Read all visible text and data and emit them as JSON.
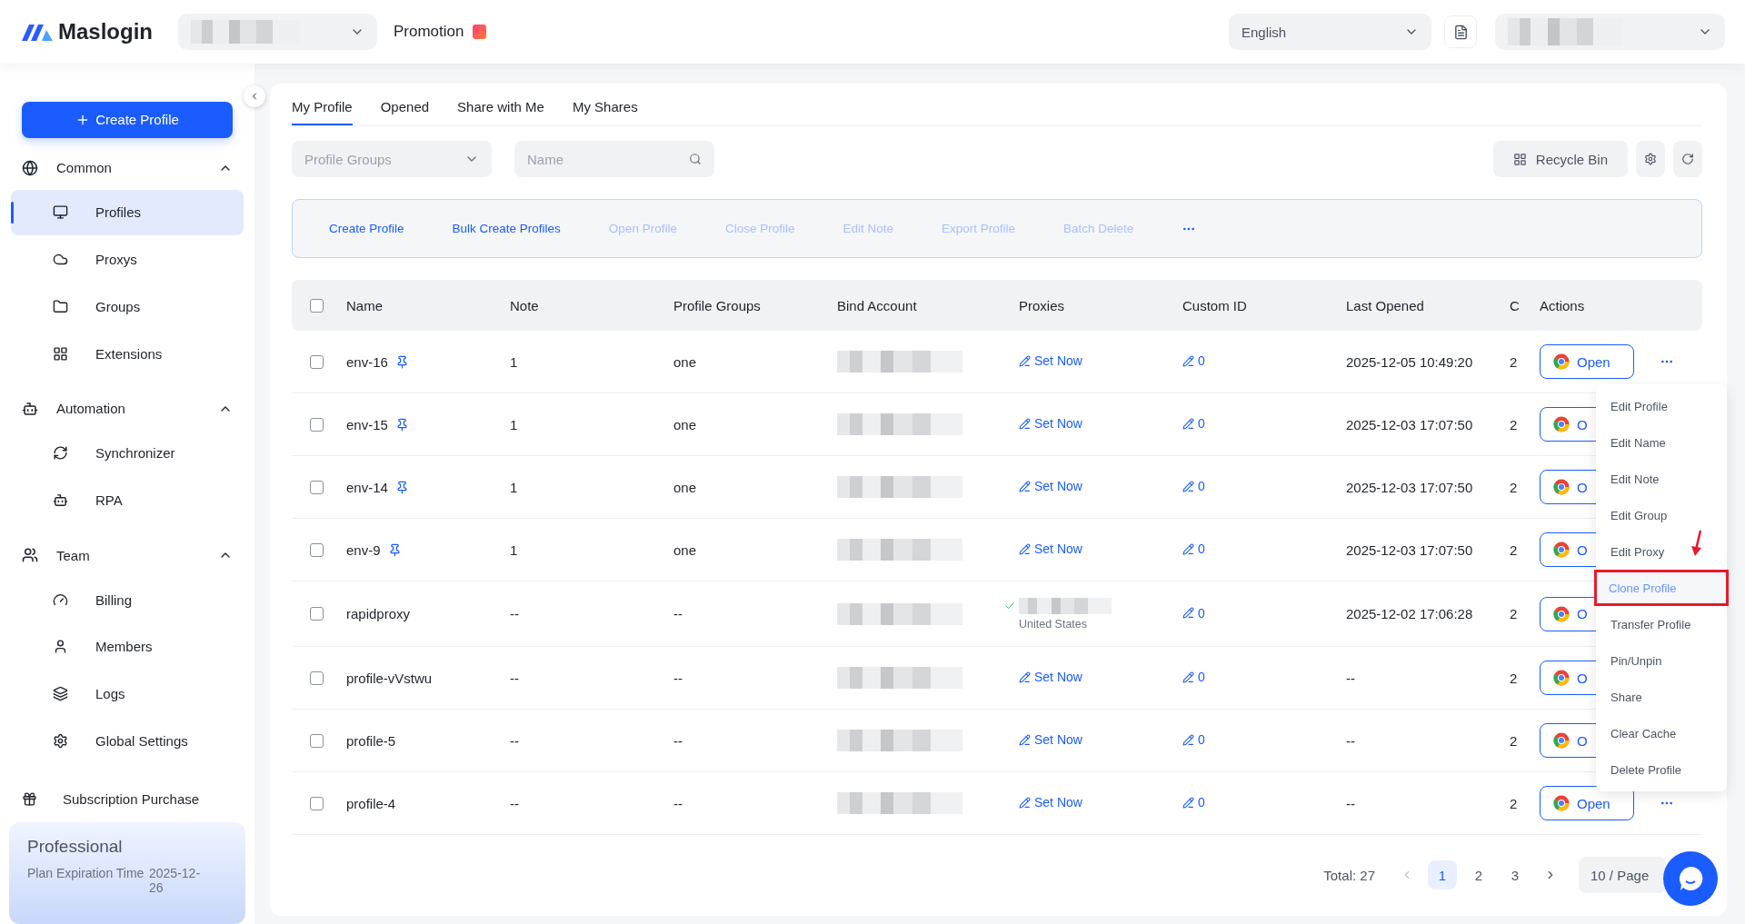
{
  "header": {
    "logo_text": "Maslogin",
    "promotion": "Promotion",
    "language": "English"
  },
  "sidebar": {
    "create_button": "Create Profile",
    "sections": [
      {
        "label": "Common",
        "expanded": true,
        "children": [
          {
            "label": "Profiles",
            "selected": true
          },
          {
            "label": "Proxys",
            "selected": false
          },
          {
            "label": "Groups",
            "selected": false
          },
          {
            "label": "Extensions",
            "selected": false
          }
        ]
      },
      {
        "label": "Automation",
        "expanded": true,
        "children": [
          {
            "label": "Synchronizer",
            "selected": false
          },
          {
            "label": "RPA",
            "selected": false
          }
        ]
      },
      {
        "label": "Team",
        "expanded": true,
        "children": [
          {
            "label": "Billing",
            "selected": false
          },
          {
            "label": "Members",
            "selected": false
          },
          {
            "label": "Logs",
            "selected": false
          },
          {
            "label": "Global Settings",
            "selected": false
          }
        ]
      }
    ],
    "footer_item": "Subscription Purchase",
    "plan": {
      "name": "Professional",
      "expiry_label": "Plan Expiration Time",
      "expiry_value": "2025-12-26"
    }
  },
  "main": {
    "tabs": [
      {
        "label": "My Profile",
        "selected": true
      },
      {
        "label": "Opened",
        "selected": false
      },
      {
        "label": "Share with Me",
        "selected": false
      },
      {
        "label": "My Shares",
        "selected": false
      }
    ],
    "group_select": {
      "placeholder": "Profile Groups"
    },
    "search": {
      "placeholder": "Name"
    },
    "recycle_bin": "Recycle Bin",
    "bulk_actions": [
      {
        "label": "Create Profile",
        "disabled": false
      },
      {
        "label": "Bulk Create Profiles",
        "disabled": false
      },
      {
        "label": "Open Profile",
        "disabled": true
      },
      {
        "label": "Close Profile",
        "disabled": true
      },
      {
        "label": "Edit Note",
        "disabled": true
      },
      {
        "label": "Export Profile",
        "disabled": true
      },
      {
        "label": "Batch Delete",
        "disabled": true
      }
    ],
    "table": {
      "select_all_checked": false,
      "columns": [
        "Name",
        "Note",
        "Profile Groups",
        "Bind Account",
        "Proxies",
        "Custom ID",
        "Last Opened",
        "C",
        "Actions"
      ],
      "rows": [
        {
          "checked": false,
          "name": "env-16",
          "pinned": true,
          "note": "1",
          "group": "one",
          "proxy": {
            "kind": "unset",
            "label": "Set Now"
          },
          "custom_id": "0",
          "last_opened": "2025-12-05 10:49:20",
          "column_9": "2",
          "open_label": "Open"
        },
        {
          "checked": false,
          "name": "env-15",
          "pinned": true,
          "note": "1",
          "group": "one",
          "proxy": {
            "kind": "unset",
            "label": "Set Now"
          },
          "custom_id": "0",
          "last_opened": "2025-12-03 17:07:50",
          "column_9": "2",
          "open_label": "O"
        },
        {
          "checked": false,
          "name": "env-14",
          "pinned": true,
          "note": "1",
          "group": "one",
          "proxy": {
            "kind": "unset",
            "label": "Set Now"
          },
          "custom_id": "0",
          "last_opened": "2025-12-03 17:07:50",
          "column_9": "2",
          "open_label": "O"
        },
        {
          "checked": false,
          "name": "env-9",
          "pinned": true,
          "note": "1",
          "group": "one",
          "proxy": {
            "kind": "unset",
            "label": "Set Now"
          },
          "custom_id": "0",
          "last_opened": "2025-12-03 17:07:50",
          "column_9": "2",
          "open_label": "O"
        },
        {
          "checked": false,
          "name": "rapidproxy",
          "pinned": false,
          "note": "--",
          "group": "--",
          "proxy": {
            "kind": "set",
            "country": "United States"
          },
          "custom_id": "0",
          "last_opened": "2025-12-02 17:06:28",
          "column_9": "2",
          "open_label": "O"
        },
        {
          "checked": false,
          "name": "profile-vVstwu",
          "pinned": false,
          "note": "--",
          "group": "--",
          "proxy": {
            "kind": "unset",
            "label": "Set Now"
          },
          "custom_id": "0",
          "last_opened": "--",
          "column_9": "2",
          "open_label": "O"
        },
        {
          "checked": false,
          "name": "profile-5",
          "pinned": false,
          "note": "--",
          "group": "--",
          "proxy": {
            "kind": "unset",
            "label": "Set Now"
          },
          "custom_id": "0",
          "last_opened": "--",
          "column_9": "2",
          "open_label": "O"
        },
        {
          "checked": false,
          "name": "profile-4",
          "pinned": false,
          "note": "--",
          "group": "--",
          "proxy": {
            "kind": "unset",
            "label": "Set Now"
          },
          "custom_id": "0",
          "last_opened": "--",
          "column_9": "2",
          "open_label": "Open"
        }
      ]
    },
    "row_menu": [
      {
        "label": "Edit Profile",
        "selected": false
      },
      {
        "label": "Edit Name",
        "selected": false
      },
      {
        "label": "Edit Note",
        "selected": false
      },
      {
        "label": "Edit Group",
        "selected": false
      },
      {
        "label": "Edit Proxy",
        "selected": false
      },
      {
        "label": "Clone Profile",
        "selected": true
      },
      {
        "label": "Transfer Profile",
        "selected": false
      },
      {
        "label": "Pin/Unpin",
        "selected": false
      },
      {
        "label": "Share",
        "selected": false
      },
      {
        "label": "Clear Cache",
        "selected": false
      },
      {
        "label": "Delete Profile",
        "selected": false
      }
    ],
    "pagination": {
      "total": "Total: 27",
      "pages": [
        {
          "label": "1",
          "selected": true
        },
        {
          "label": "2",
          "selected": false
        },
        {
          "label": "3",
          "selected": false
        }
      ],
      "page_size": "10 / Page"
    }
  }
}
